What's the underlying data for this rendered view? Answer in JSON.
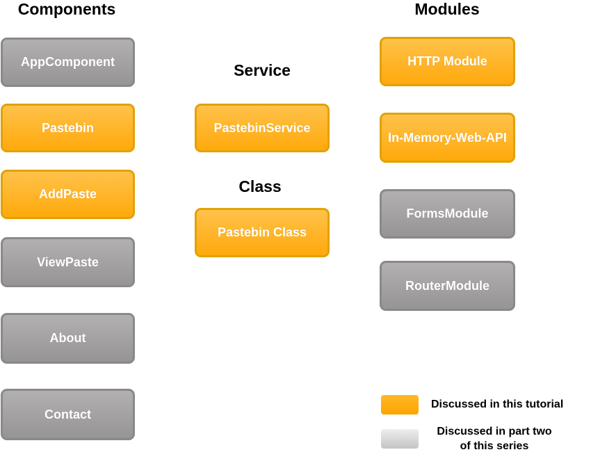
{
  "headers": {
    "components": "Components",
    "service": "Service",
    "class": "Class",
    "modules": "Modules"
  },
  "components": [
    "AppComponent",
    "Pastebin",
    "AddPaste",
    "ViewPaste",
    "About",
    "Contact"
  ],
  "service": [
    "PastebinService"
  ],
  "class": [
    "Pastebin Class"
  ],
  "modules": [
    "HTTP Module",
    "In-Memory-Web-API",
    "FormsModule",
    "RouterModule"
  ],
  "legend": {
    "current": "Discussed in this tutorial",
    "future_line1": "Discussed in part two",
    "future_line2": "of this series"
  },
  "colors": {
    "discussed": "#ffaa10",
    "future": "#9e9c9d"
  }
}
